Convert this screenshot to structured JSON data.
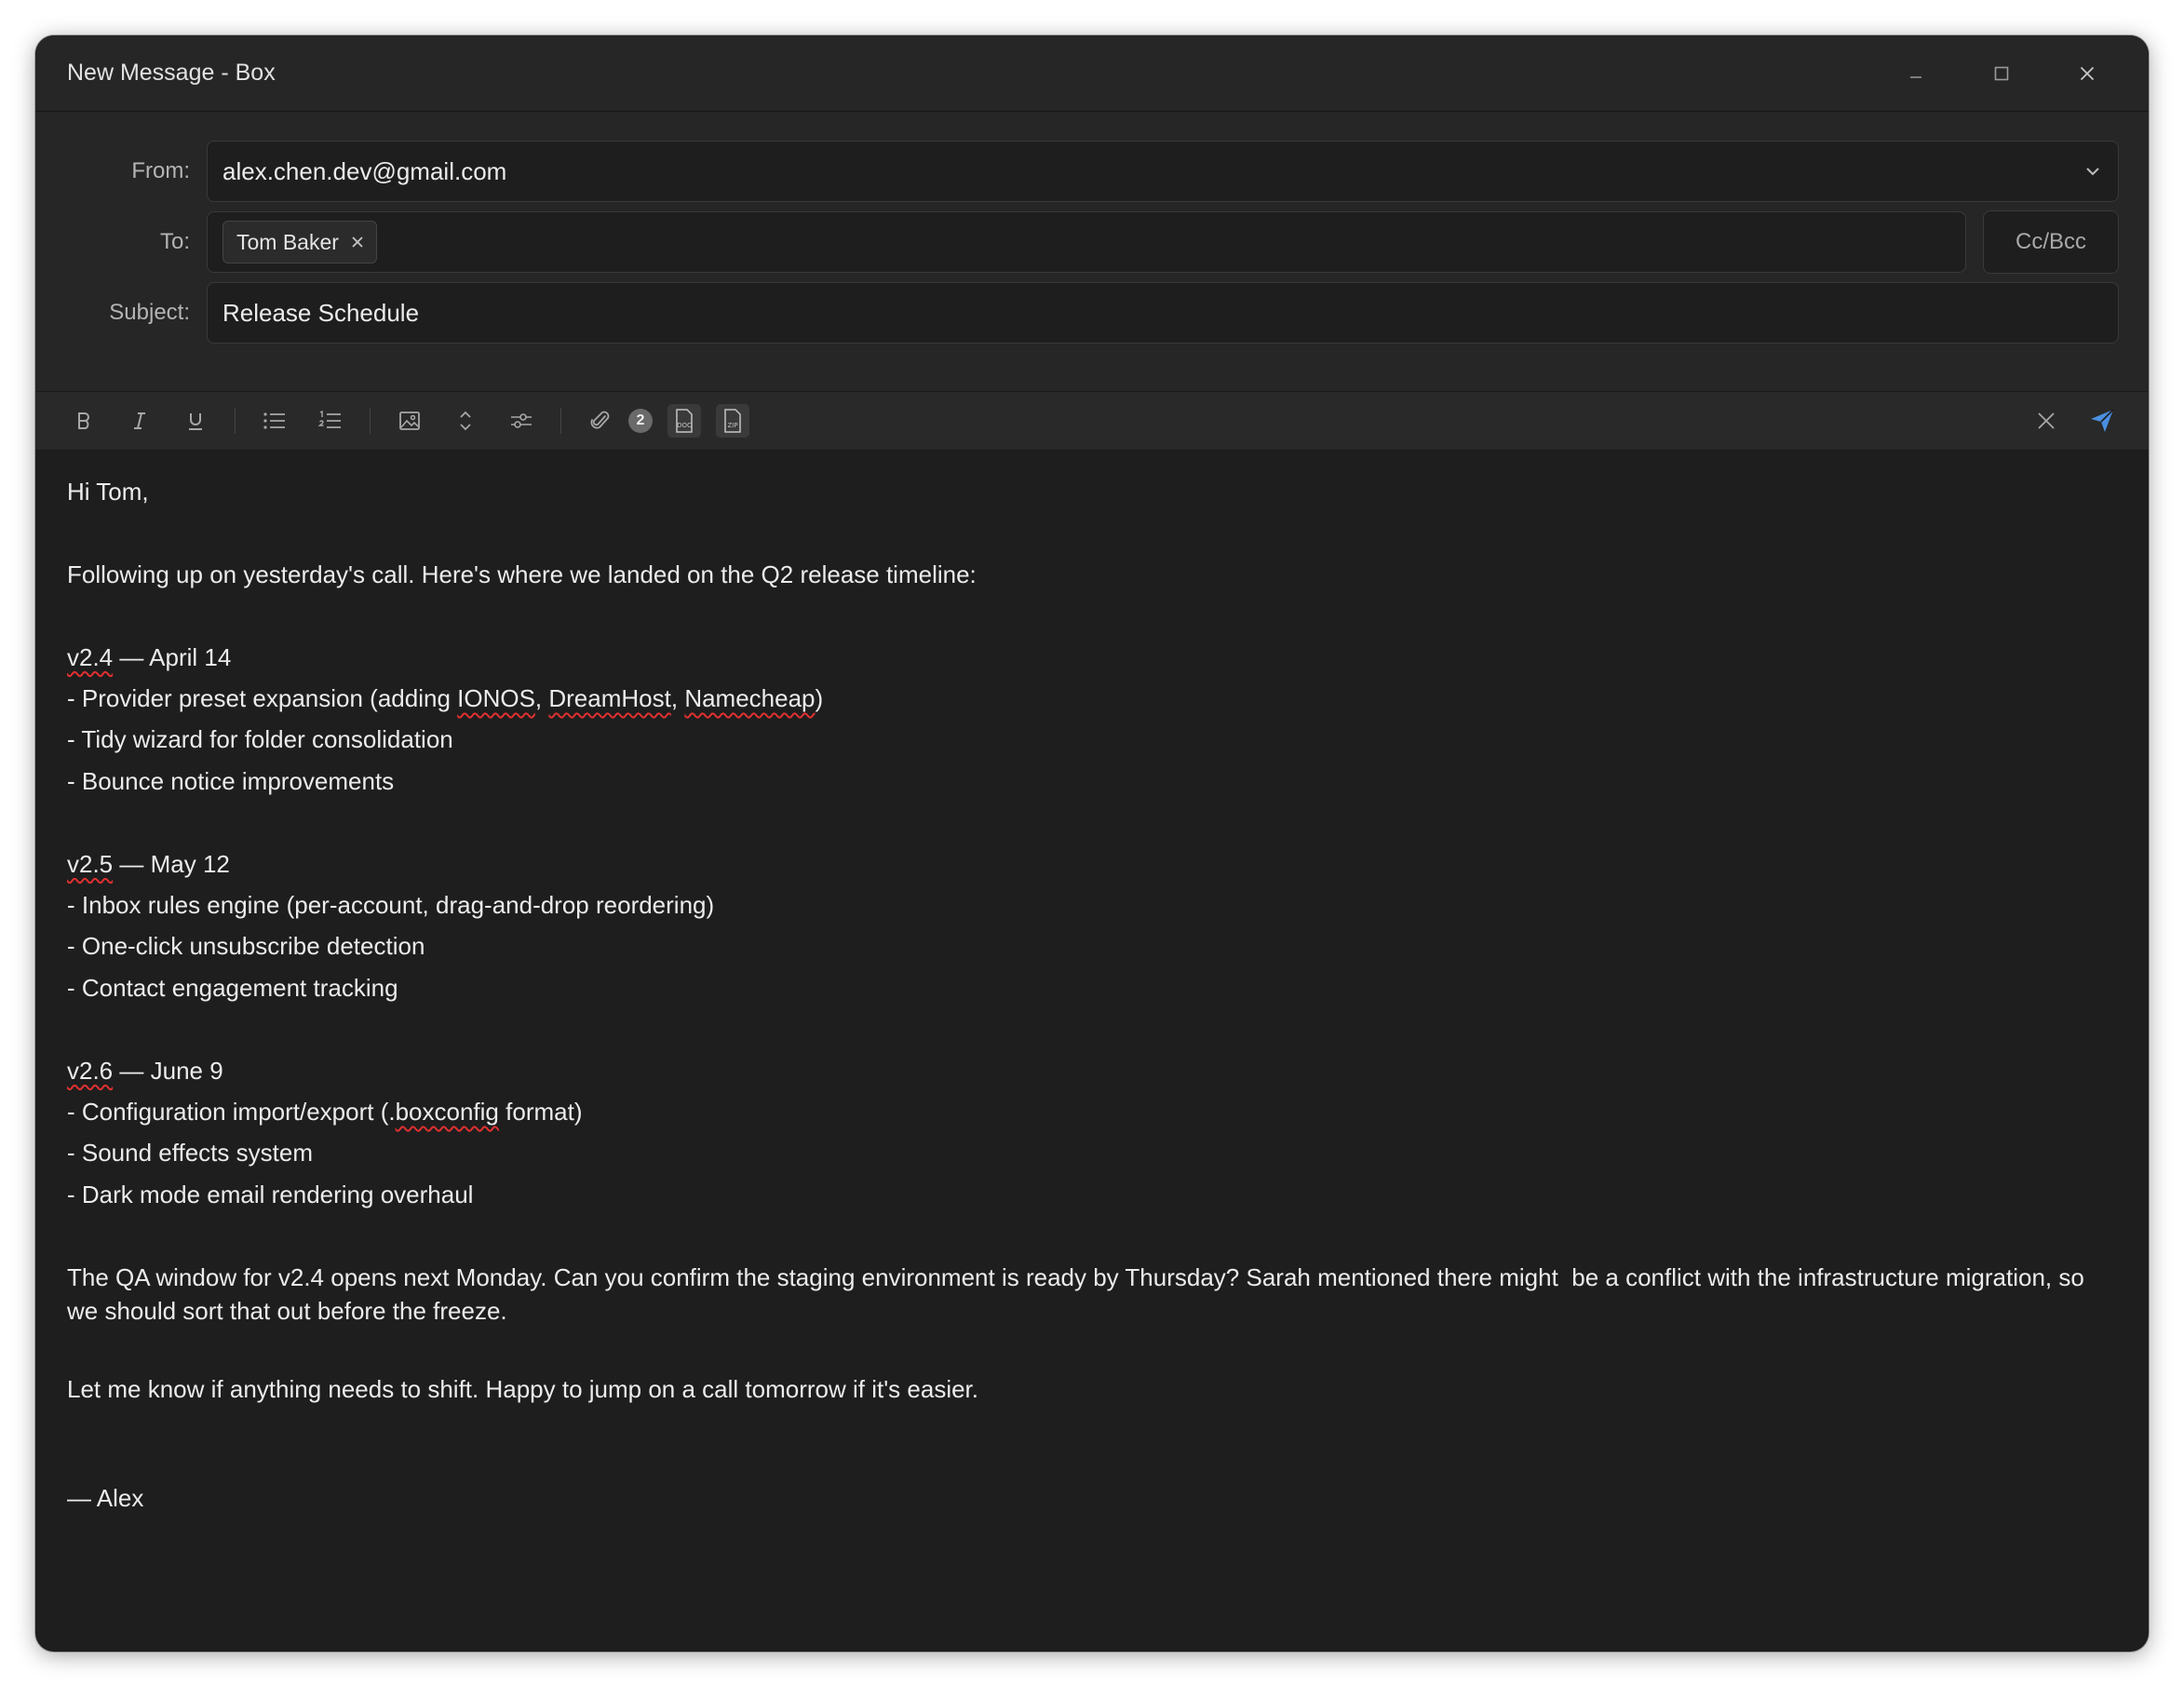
{
  "window": {
    "title": "New Message - Box"
  },
  "compose": {
    "from_label": "From:",
    "from_value": "alex.chen.dev@gmail.com",
    "to_label": "To:",
    "to_chip": "Tom Baker",
    "ccbcc_label": "Cc/Bcc",
    "subject_label": "Subject:",
    "subject_value": "Release Schedule"
  },
  "toolbar": {
    "attachment_count": "2",
    "file1_label": "DOC",
    "file2_label": "ZIP",
    "accent": "#4a8fe0"
  },
  "body": {
    "greeting": "Hi Tom,",
    "intro": "Following up on yesterday's call. Here's where we landed on the Q2 release timeline:",
    "v24_ver": "v2.4",
    "v24_date": " — April 14",
    "v24_i1_pre": "- Provider preset expansion (adding ",
    "v24_i1_a": "IONOS",
    "v24_i1_sep1": ", ",
    "v24_i1_b": "DreamHost",
    "v24_i1_sep2": ", ",
    "v24_i1_c": "Namecheap",
    "v24_i1_post": ")",
    "v24_i2": "- Tidy wizard for folder consolidation",
    "v24_i3": "- Bounce notice improvements",
    "v25_ver": "v2.5",
    "v25_date": " — May 12",
    "v25_i1": "- Inbox rules engine (per-account, drag-and-drop reordering)",
    "v25_i2": "- One-click unsubscribe detection",
    "v25_i3": "- Contact engagement tracking",
    "v26_ver": "v2.6",
    "v26_date": " — June 9",
    "v26_i1_pre": "- Configuration import/export (.",
    "v26_i1_word": "boxconfig",
    "v26_i1_post": " format)",
    "v26_i2": "- Sound effects system",
    "v26_i3": "- Dark mode email rendering overhaul",
    "qa_para": "The QA window for v2.4 opens next Monday. Can you confirm the staging environment is ready by Thursday? Sarah mentioned there might  be a conflict with the infrastructure migration, so we should sort that out before the freeze.",
    "closing": "Let me know if anything needs to shift. Happy to jump on a call tomorrow if it's easier.",
    "signature": "— Alex"
  }
}
